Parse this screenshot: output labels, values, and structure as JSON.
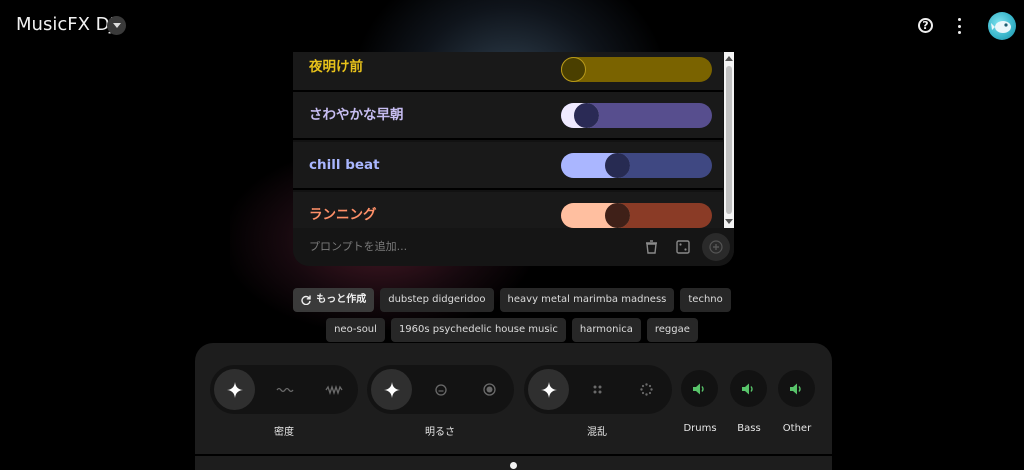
{
  "app": {
    "title": "MusicFX DJ"
  },
  "colors": {
    "background": "#000000",
    "panel": "#121212",
    "accent_green": "#58c46a"
  },
  "prompts": [
    {
      "label": "夜明け前",
      "level": 0.0,
      "text_color": "#e8c21a",
      "track_color": "#7a6300",
      "fill_color": "#7a6300",
      "thumb_color": "#4a3f00",
      "thumb_border": "#b89a1a"
    },
    {
      "label": "さわやかな早朝",
      "level": 0.1,
      "text_color": "#c7bdf2",
      "track_color": "#574e8e",
      "fill_color": "#efeaff",
      "thumb_color": "#2a2a55",
      "thumb_border": "#2a2a55"
    },
    {
      "label": "chill beat",
      "level": 0.35,
      "text_color": "#a9b7ff",
      "track_color": "#3f4882",
      "fill_color": "#aab6ff",
      "thumb_color": "#272b52",
      "thumb_border": "#272b52"
    },
    {
      "label": "ランニング",
      "level": 0.35,
      "text_color": "#ff9068",
      "track_color": "#8a3b26",
      "fill_color": "#ffbfa0",
      "thumb_color": "#3f2018",
      "thumb_border": "#3f2018"
    }
  ],
  "prompt_input": {
    "placeholder": "プロンプトを追加..."
  },
  "suggestions": {
    "more_label": "もっと作成",
    "chips_row1": [
      "dubstep didgeridoo",
      "heavy metal marimba madness",
      "techno"
    ],
    "chips_row2": [
      "neo-soul",
      "1960s psychedelic house music",
      "harmonica",
      "reggae"
    ]
  },
  "controls": {
    "density": {
      "label": "密度",
      "selected": 0
    },
    "brightness": {
      "label": "明るさ",
      "selected": 0
    },
    "chaos": {
      "label": "混乱",
      "selected": 0
    },
    "stems": [
      {
        "label": "Drums"
      },
      {
        "label": "Bass"
      },
      {
        "label": "Other"
      }
    ]
  },
  "icons": [
    "chevron-down-icon",
    "help-icon",
    "more-vert-icon",
    "avatar",
    "trash-icon",
    "dice-icon",
    "add-icon",
    "refresh-icon",
    "sparkle-icon",
    "wave-icon",
    "squiggle-icon",
    "face-icon",
    "target-icon",
    "grid-icon",
    "scatter-icon",
    "volume-icon"
  ]
}
